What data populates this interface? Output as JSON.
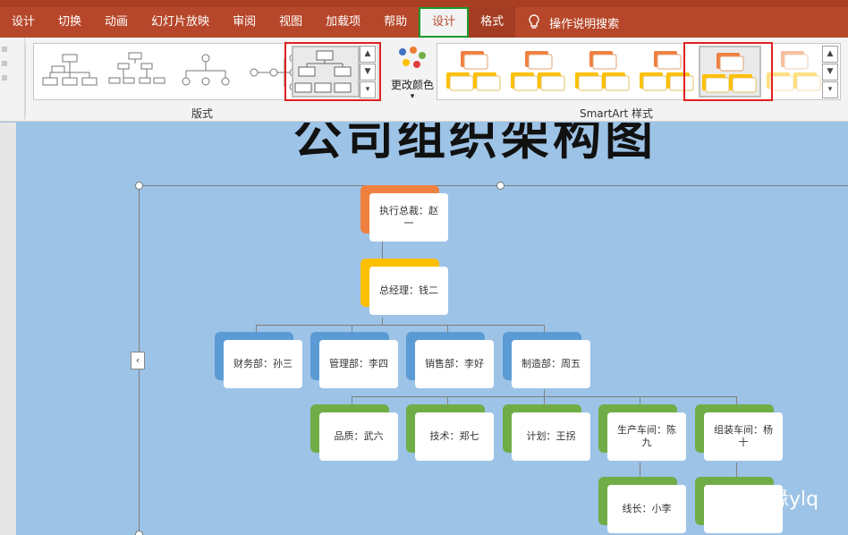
{
  "tabs": [
    "设计",
    "切换",
    "动画",
    "幻灯片放映",
    "审阅",
    "视图",
    "加载项",
    "帮助"
  ],
  "context_tabs": {
    "design": "设计",
    "format": "格式"
  },
  "tell_me": "操作说明搜索",
  "ribbon": {
    "layouts_group_label": "版式",
    "styles_group_label": "SmartArt 样式",
    "change_colors_label": "更改颜色",
    "change_colors_arrow": "▾"
  },
  "slide": {
    "title": "公司组织架构图",
    "collapse_glyph": "‹"
  },
  "org": {
    "ceo": "执行总裁：赵一",
    "gm": "总经理：钱二",
    "departments": [
      "财务部：孙三",
      "管理部：李四",
      "销售部：李好",
      "制造部：周五"
    ],
    "manufacturing": [
      "品质：武六",
      "技术：郑七",
      "计划：王拐",
      "生产车间：陈九",
      "组装车间：杨十"
    ],
    "lines": [
      "线长：小李",
      ""
    ]
  },
  "watermark": "情缘ylq",
  "colors": {
    "tab_bar": "#b7472a",
    "slide_bg": "#9dc3e6",
    "ceo_fill": "#f08040",
    "gm_fill": "#ffc000",
    "dept_fill": "#5b9bd5",
    "team_fill": "#70ad47",
    "highlight_red": "#e02020",
    "highlight_green": "#1a9a2e"
  }
}
